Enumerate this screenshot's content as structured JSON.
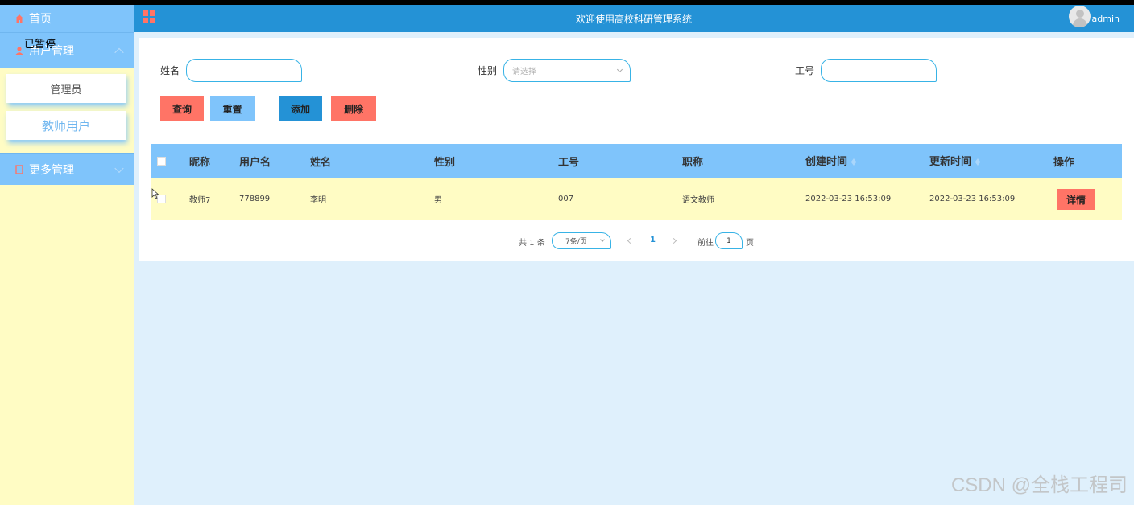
{
  "sidebar": {
    "home": "首页",
    "user_mgmt": "用户管理",
    "paused_overlay": "已暂停",
    "sub_items": [
      "管理员",
      "教师用户"
    ],
    "more_mgmt": "更多管理"
  },
  "header": {
    "title": "欢迎使用高校科研管理系统",
    "username": "admin"
  },
  "search": {
    "name_label": "姓名",
    "gender_label": "性别",
    "gender_placeholder": "请选择",
    "jobno_label": "工号"
  },
  "actions": {
    "query": "查询",
    "reset": "重置",
    "add": "添加",
    "delete": "删除"
  },
  "table": {
    "columns": [
      "昵称",
      "用户名",
      "姓名",
      "性别",
      "工号",
      "职称",
      "创建时间",
      "更新时间",
      "操作"
    ],
    "rows": [
      {
        "nickname": "教师7",
        "username": "778899",
        "name": "李明",
        "gender": "男",
        "jobno": "007",
        "title": "语文教师",
        "created": "2022-03-23 16:53:09",
        "updated": "2022-03-23 16:53:09",
        "action": "详情"
      }
    ]
  },
  "pagination": {
    "total": "共 1 条",
    "page_size": "7条/页",
    "current_page": "1",
    "goto_label": "前往",
    "goto_value": "1",
    "page_suffix": "页"
  },
  "watermark": "CSDN @全栈工程司",
  "colors": {
    "header_blue": "#2492d6",
    "light_blue": "#7fc4fb",
    "sidebar_yellow": "#fffcc4",
    "accent_red": "#ff7466",
    "page_bg": "#dff0fc"
  }
}
